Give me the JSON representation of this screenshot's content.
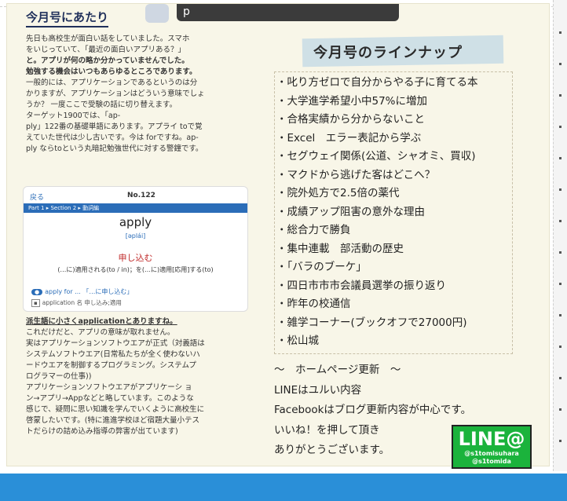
{
  "left": {
    "header": "今月号にあたり",
    "tooltip_text": "p",
    "para1": [
      "先日も高校生が面白い話をしていました。スマホ",
      "をいじっていて、「最近の面白いアプリある？」",
      "と。アプリが何の略か分かっていませんでした。",
      "勉強する機会はいつもあらゆるところであります。",
      "一般的には、アプリケーションであるというのは分",
      "かりますが、アプリケーションはどういう意味でしょ",
      "うか？ 一度ここで受験の話に切り替えます。",
      "ターゲット1900では、「ap-",
      "ply」122番の基礎単語にあります。アプライ toで覚",
      "えていた世代は少し古いです。今は forですね。ap-",
      "ply ならtoという丸暗記勉強世代に対する警鐘です。"
    ],
    "dict": {
      "back": "戻る",
      "number": "No.122",
      "path": "Part 1 ▸ Section 2 ▸ 動詞編",
      "word": "apply",
      "pron": "[əplái]",
      "meaning": "申し込む",
      "gloss": "(…に)適用される(to / in)；を(…に)適用[応用]する(to)",
      "example1": "apply for ... 「…に申し込む」",
      "example2": "application 名 申し込み;適用"
    },
    "para2": [
      "派生語に小さくapplicationとありますね。",
      "これだけだと、アプリの意味が取れません。",
      "実はアプリケーションソフトウエアが正式（対義語は",
      "システムソフトウエア(日常私たちが全く使わないハ",
      "ードウエアを制御するプログラミング。システムプ",
      "ログラマーの仕事))",
      "アプリケーションソフトウエアがアプリケーシ ョ",
      "ン→アプリ→Appなどと略しています。このような",
      "感じで、疑問に思い知識を学んでいくように高校生に",
      "啓蒙したいです。(特に進進学校ほど宿題大量小テス",
      "トだらけの詰め込み指導の弊害が出ています)"
    ]
  },
  "right": {
    "title": "今月号のラインナップ",
    "items": [
      "・叱り方ゼロで自分からやる子に育てる本",
      "・大学進学希望小中57%に増加",
      "・合格実績から分からないこと",
      "・Excel　エラー表記から学ぶ",
      "・セグウェイ関係(公道、シャオミ、買収)",
      "・マクドから逃げた客はどこへ？",
      "・院外処方で2.5倍の薬代",
      "・成績アップ阻害の意外な理由",
      "・総合力で勝負",
      "・集中連載　部活動の歴史",
      "・「バラのブーケ」",
      "・四日市市市会議員選挙の振り返り",
      "・昨年の校通信",
      "・雑学コーナー(ブックオフで27000円)",
      "・松山城"
    ],
    "homepage": [
      "～　ホームページ更新　～",
      "LINEはユルい内容",
      "Facebookはブログ更新内容が中心です。",
      "いいね！を押して頂き",
      "ありがとうございます。"
    ],
    "badge": {
      "big": "LINE@",
      "line1": "@s1tomisuhara",
      "line2": "@s1tomida"
    }
  },
  "colors": {
    "accent_blue": "#2a8fd8",
    "line_green": "#1bb33c"
  }
}
